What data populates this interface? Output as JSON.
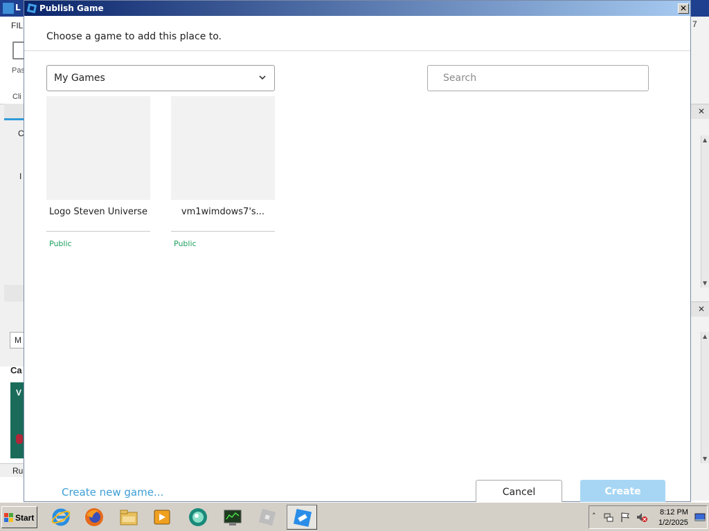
{
  "background_app": {
    "title_fragment": "L",
    "menu_fragment": "FIL",
    "paste_fragment": "Pas",
    "clip_fragment": "Cli",
    "tab_fragment_1": "C",
    "label_fragment": "I",
    "dropdown_fragment": "M",
    "section_fragment": "Ca",
    "thumb_fragment": "V",
    "status_fragment": "Ru",
    "right_fragment": "7"
  },
  "dialog": {
    "title": "Publish Game",
    "close_glyph": "✕",
    "prompt": "Choose a game to add this place to.",
    "games_select": {
      "value": "My Games"
    },
    "search": {
      "placeholder": "Search",
      "value": ""
    },
    "games": [
      {
        "name": "Logo Steven Universe",
        "status": "Public"
      },
      {
        "name": "vm1wimdows7's...",
        "status": "Public"
      }
    ],
    "create_new_link": "Create new game...",
    "cancel_label": "Cancel",
    "create_label": "Create"
  },
  "taskbar": {
    "start_label": "Start",
    "apps": [
      "internet-explorer",
      "firefox",
      "file-explorer",
      "media-player",
      "network-app",
      "terminal-app",
      "roblox-player",
      "roblox-studio"
    ],
    "clock_time": "8:12 PM",
    "clock_date": "1/2/2025"
  },
  "colors": {
    "title_gradient_start": "#0a246a",
    "link": "#3c9ed6",
    "status_public": "#1fa060",
    "create_disabled": "#a7d6f4"
  }
}
